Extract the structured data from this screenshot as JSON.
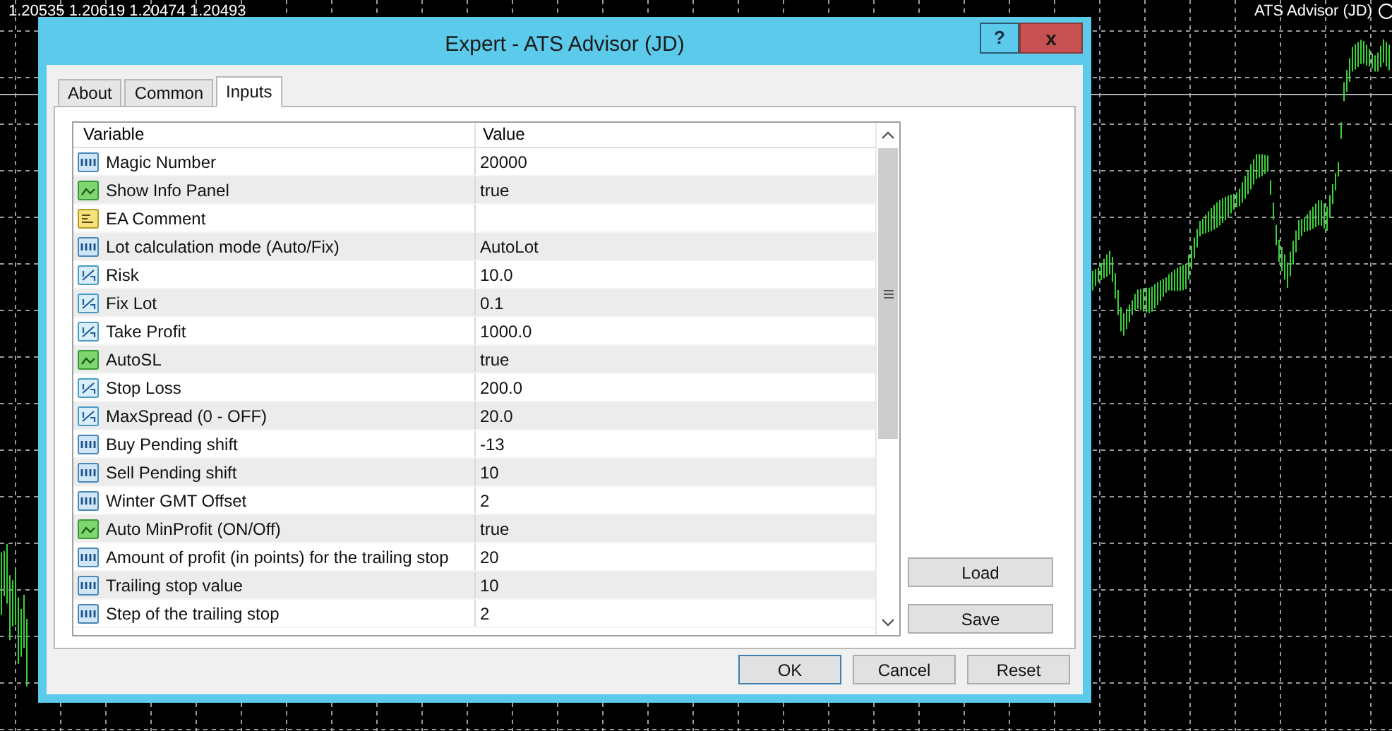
{
  "chart": {
    "ohlc": "1.20535 1.20619 1.20474 1.20493",
    "label": "ATS Advisor (JD)"
  },
  "dialog": {
    "title": "Expert - ATS Advisor (JD)",
    "help_button": "?",
    "close_button": "x",
    "tabs": [
      {
        "label": "About",
        "selected": false
      },
      {
        "label": "Common",
        "selected": false
      },
      {
        "label": "Inputs",
        "selected": true
      }
    ],
    "table": {
      "columns": [
        "Variable",
        "Value"
      ],
      "rows": [
        {
          "kind": "int",
          "variable": "Magic Number",
          "value": "20000"
        },
        {
          "kind": "bool",
          "variable": "Show Info Panel",
          "value": "true"
        },
        {
          "kind": "string",
          "variable": "EA Comment"
        },
        {
          "kind": "int",
          "variable": "Lot calculation mode (Auto/Fix)",
          "value": "AutoLot"
        },
        {
          "kind": "double",
          "variable": "Risk",
          "value": "10.0"
        },
        {
          "kind": "double",
          "variable": "Fix Lot",
          "value": "0.1"
        },
        {
          "kind": "double",
          "variable": "Take Profit",
          "value": "1000.0"
        },
        {
          "kind": "bool",
          "variable": "AutoSL",
          "value": "true"
        },
        {
          "kind": "double",
          "variable": "Stop Loss",
          "value": "200.0"
        },
        {
          "kind": "double",
          "variable": "MaxSpread (0 - OFF)",
          "value": "20.0"
        },
        {
          "kind": "int",
          "variable": "Buy Pending shift",
          "value": "-13"
        },
        {
          "kind": "int",
          "variable": "Sell Pending shift",
          "value": "10"
        },
        {
          "kind": "int",
          "variable": "Winter GMT Offset",
          "value": "2"
        },
        {
          "kind": "bool",
          "variable": "Auto MinProfit (ON/Off)",
          "value": "true"
        },
        {
          "kind": "int",
          "variable": "Amount of profit (in points) for the trailing stop",
          "value": "20"
        },
        {
          "kind": "int",
          "variable": "Trailing stop value",
          "value": "10"
        },
        {
          "kind": "int",
          "variable": "Step of the trailing stop",
          "value": "2"
        }
      ]
    },
    "side_buttons": [
      "Load",
      "Save"
    ],
    "buttons": [
      "OK",
      "Cancel",
      "Reset"
    ]
  }
}
